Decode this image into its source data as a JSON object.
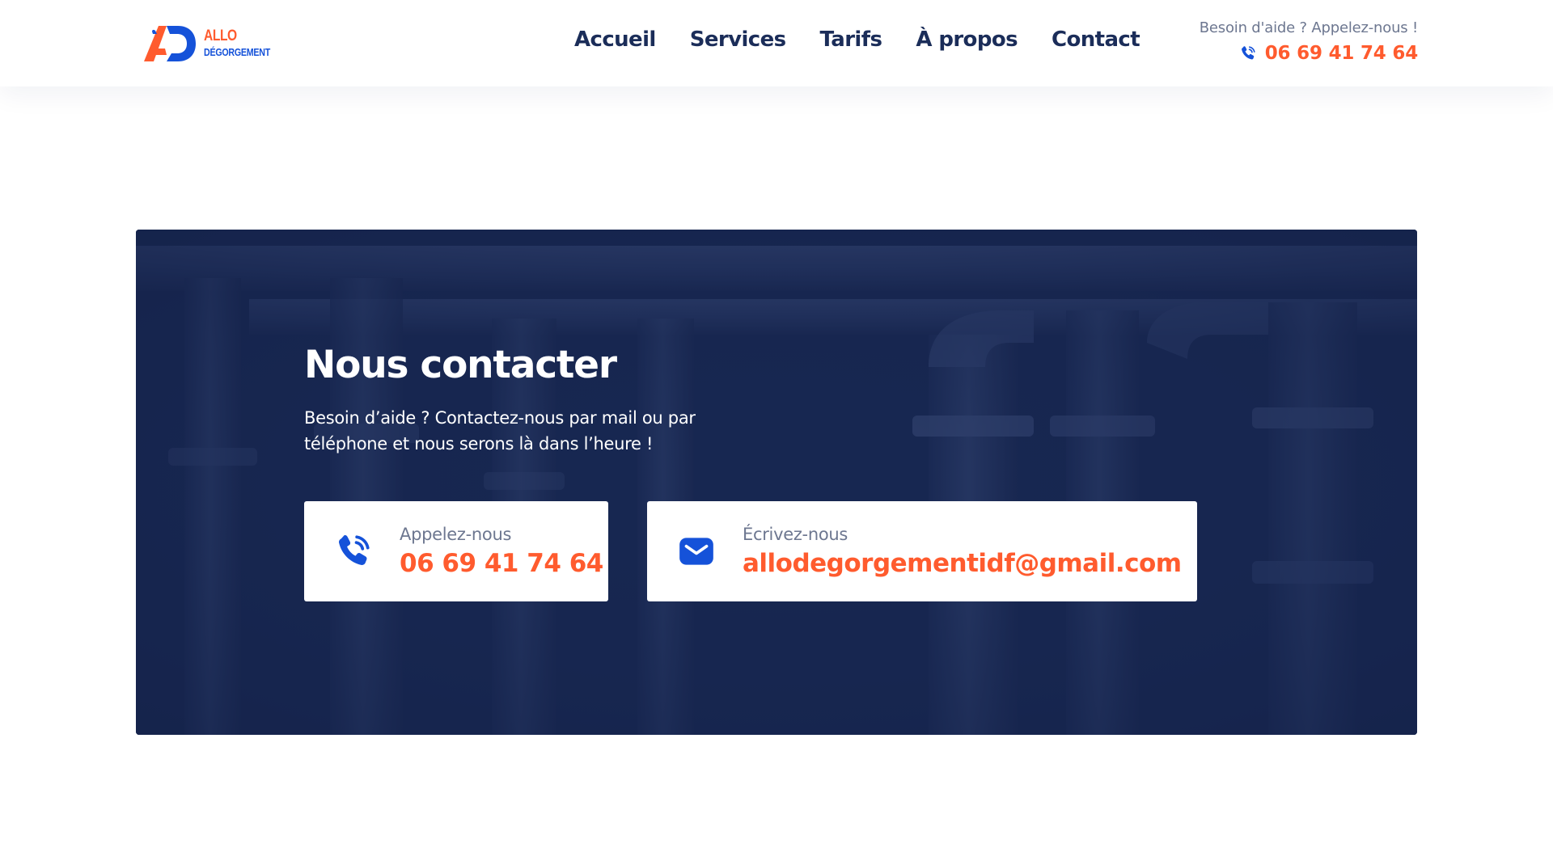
{
  "brand": {
    "name_line1": "ALLO",
    "name_line2": "DÉGORGEMENT",
    "logo_icon": "ad-monogram-logo",
    "colors": {
      "orange": "#ff5b2e",
      "blue": "#1552d9",
      "navy": "#1b2d59"
    }
  },
  "nav": {
    "items": [
      {
        "label": "Accueil"
      },
      {
        "label": "Services"
      },
      {
        "label": "Tarifs"
      },
      {
        "label": "À propos"
      },
      {
        "label": "Contact"
      }
    ]
  },
  "header_help": {
    "text": "Besoin d'aide ? Appelez-nous !",
    "phone": "06 69 41 74 64",
    "icon": "phone-ringing-icon"
  },
  "contact": {
    "title": "Nous contacter",
    "text": "Besoin d’aide ? Contactez-nous par mail ou par téléphone et nous serons là dans l’heure !",
    "background": "industrial-pipes-photo",
    "cards": {
      "phone": {
        "label": "Appelez-nous",
        "value": "06 69 41 74 64",
        "icon": "phone-ringing-icon"
      },
      "mail": {
        "label": "Écrivez-nous",
        "value": "allodegorgementidf@gmail.com",
        "icon": "envelope-icon"
      }
    }
  }
}
